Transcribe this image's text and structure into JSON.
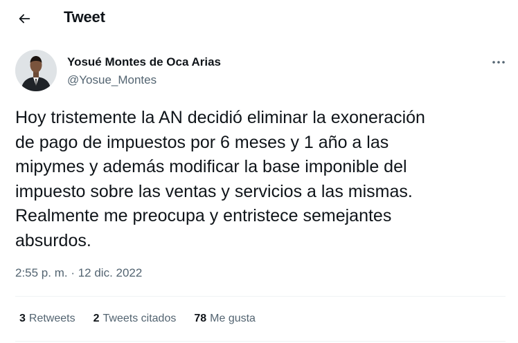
{
  "header": {
    "back_icon": "arrow-left-icon",
    "title": "Tweet"
  },
  "author": {
    "display_name": "Yosué Montes de Oca Arias",
    "handle": "@Yosue_Montes",
    "avatar_icon": "avatar-photo",
    "more_icon": "more-horizontal-icon"
  },
  "tweet": {
    "text": "Hoy tristemente la AN decidió eliminar la exoneración\nde pago de impuestos por 6 meses y 1 año a las\nmipymes y además modificar la base imponible del\nimpuesto sobre las ventas y servicios a las mismas.\nRealmente me preocupa y entristece semejantes\nabsurdos.",
    "timestamp": "2:55 p. m. · 12 dic. 2022"
  },
  "stats": [
    {
      "count": "3",
      "label": "Retweets"
    },
    {
      "count": "2",
      "label": "Tweets citados"
    },
    {
      "count": "78",
      "label": "Me gusta"
    }
  ],
  "colors": {
    "text_primary": "#0f1419",
    "text_secondary": "#536471",
    "divider": "#eff3f4"
  }
}
